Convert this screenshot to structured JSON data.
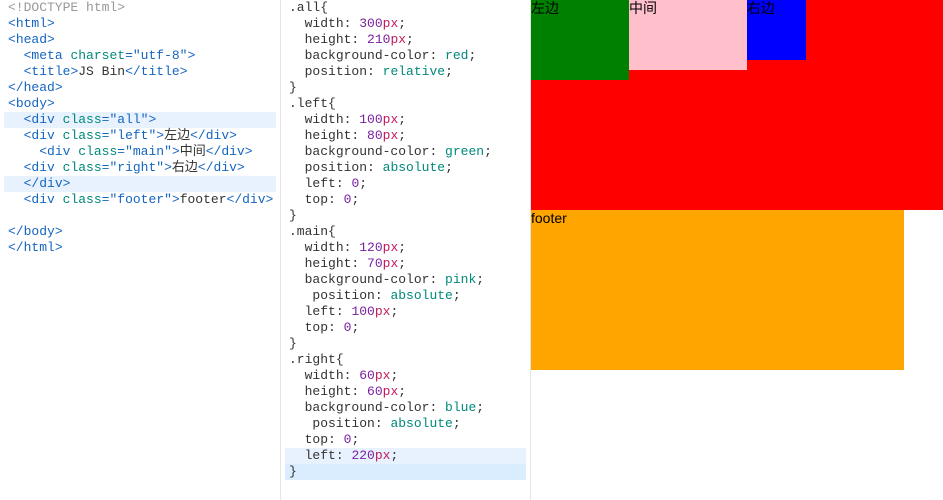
{
  "html_panel": {
    "lines": [
      {
        "kind": "plain",
        "segments": [
          [
            "doctype",
            "<!DOCTYPE html>"
          ]
        ]
      },
      {
        "kind": "opentag",
        "tag": "html",
        "attrs": []
      },
      {
        "kind": "opentag",
        "tag": "head",
        "attrs": []
      },
      {
        "kind": "plain",
        "segments": [
          [
            "text",
            "  "
          ],
          [
            "punc",
            "<"
          ],
          [
            "tag",
            "meta"
          ],
          [
            "text",
            " "
          ],
          [
            "attr",
            "charset"
          ],
          [
            "punc",
            "="
          ],
          [
            "str",
            "\"utf-8\""
          ],
          [
            "punc",
            ">"
          ]
        ]
      },
      {
        "kind": "plain",
        "segments": [
          [
            "text",
            "  "
          ],
          [
            "punc",
            "<"
          ],
          [
            "tag",
            "title"
          ],
          [
            "punc",
            ">"
          ],
          [
            "text",
            "JS Bin"
          ],
          [
            "punc",
            "</"
          ],
          [
            "tag",
            "title"
          ],
          [
            "punc",
            ">"
          ]
        ]
      },
      {
        "kind": "closetag",
        "tag": "head"
      },
      {
        "kind": "opentag",
        "tag": "body",
        "attrs": []
      },
      {
        "kind": "hl",
        "segments": [
          [
            "text",
            "  "
          ],
          [
            "punc",
            "<"
          ],
          [
            "tag",
            "div"
          ],
          [
            "text",
            " "
          ],
          [
            "attr",
            "class"
          ],
          [
            "punc",
            "="
          ],
          [
            "str",
            "\"all\""
          ],
          [
            "punc",
            ">"
          ]
        ]
      },
      {
        "kind": "plain",
        "segments": [
          [
            "text",
            "  "
          ],
          [
            "punc",
            "<"
          ],
          [
            "tag",
            "div"
          ],
          [
            "text",
            " "
          ],
          [
            "attr",
            "class"
          ],
          [
            "punc",
            "="
          ],
          [
            "str",
            "\"left\""
          ],
          [
            "punc",
            ">"
          ],
          [
            "text",
            "左边"
          ],
          [
            "punc",
            "</"
          ],
          [
            "tag",
            "div"
          ],
          [
            "punc",
            ">"
          ]
        ]
      },
      {
        "kind": "plain",
        "segments": [
          [
            "text",
            "    "
          ],
          [
            "punc",
            "<"
          ],
          [
            "tag",
            "div"
          ],
          [
            "text",
            " "
          ],
          [
            "attr",
            "class"
          ],
          [
            "punc",
            "="
          ],
          [
            "str",
            "\"main\""
          ],
          [
            "punc",
            ">"
          ],
          [
            "text",
            "中间"
          ],
          [
            "punc",
            "</"
          ],
          [
            "tag",
            "div"
          ],
          [
            "punc",
            ">"
          ]
        ]
      },
      {
        "kind": "plain",
        "segments": [
          [
            "text",
            "  "
          ],
          [
            "punc",
            "<"
          ],
          [
            "tag",
            "div"
          ],
          [
            "text",
            " "
          ],
          [
            "attr",
            "class"
          ],
          [
            "punc",
            "="
          ],
          [
            "str",
            "\"right\""
          ],
          [
            "punc",
            ">"
          ],
          [
            "text",
            "右边"
          ],
          [
            "punc",
            "</"
          ],
          [
            "tag",
            "div"
          ],
          [
            "punc",
            ">"
          ]
        ]
      },
      {
        "kind": "hl",
        "segments": [
          [
            "text",
            "  "
          ],
          [
            "punc",
            "</"
          ],
          [
            "tag",
            "div"
          ],
          [
            "punc",
            ">"
          ]
        ]
      },
      {
        "kind": "plain",
        "segments": [
          [
            "text",
            "  "
          ],
          [
            "punc",
            "<"
          ],
          [
            "tag",
            "div"
          ],
          [
            "text",
            " "
          ],
          [
            "attr",
            "class"
          ],
          [
            "punc",
            "="
          ],
          [
            "str",
            "\"footer\""
          ],
          [
            "punc",
            ">"
          ],
          [
            "text",
            "footer"
          ],
          [
            "punc",
            "</"
          ],
          [
            "tag",
            "div"
          ],
          [
            "punc",
            ">"
          ]
        ]
      },
      {
        "kind": "plain",
        "segments": [
          [
            "text",
            "  "
          ]
        ]
      },
      {
        "kind": "closetag",
        "tag": "body"
      },
      {
        "kind": "closetag",
        "tag": "html"
      }
    ]
  },
  "css_panel": {
    "lines": [
      {
        "segments": [
          [
            "sel",
            ".all"
          ],
          [
            "brace",
            "{"
          ]
        ]
      },
      {
        "segments": [
          [
            "text",
            "  "
          ],
          [
            "prop",
            "width"
          ],
          [
            "text",
            ": "
          ],
          [
            "num",
            "300"
          ],
          [
            "unit",
            "px"
          ],
          [
            "text",
            ";"
          ]
        ]
      },
      {
        "segments": [
          [
            "text",
            "  "
          ],
          [
            "prop",
            "height"
          ],
          [
            "text",
            ": "
          ],
          [
            "num",
            "210"
          ],
          [
            "unit",
            "px"
          ],
          [
            "text",
            ";"
          ]
        ]
      },
      {
        "segments": [
          [
            "text",
            "  "
          ],
          [
            "prop",
            "background-color"
          ],
          [
            "text",
            ": "
          ],
          [
            "kw",
            "red"
          ],
          [
            "text",
            ";"
          ]
        ]
      },
      {
        "segments": [
          [
            "text",
            "  "
          ],
          [
            "prop",
            "position"
          ],
          [
            "text",
            ": "
          ],
          [
            "kw",
            "relative"
          ],
          [
            "text",
            ";"
          ]
        ]
      },
      {
        "segments": [
          [
            "brace",
            "}"
          ]
        ]
      },
      {
        "segments": [
          [
            "sel",
            ".left"
          ],
          [
            "brace",
            "{"
          ]
        ]
      },
      {
        "segments": [
          [
            "text",
            "  "
          ],
          [
            "prop",
            "width"
          ],
          [
            "text",
            ": "
          ],
          [
            "num",
            "100"
          ],
          [
            "unit",
            "px"
          ],
          [
            "text",
            ";"
          ]
        ]
      },
      {
        "segments": [
          [
            "text",
            "  "
          ],
          [
            "prop",
            "height"
          ],
          [
            "text",
            ": "
          ],
          [
            "num",
            "80"
          ],
          [
            "unit",
            "px"
          ],
          [
            "text",
            ";"
          ]
        ]
      },
      {
        "segments": [
          [
            "text",
            "  "
          ],
          [
            "prop",
            "background-color"
          ],
          [
            "text",
            ": "
          ],
          [
            "kw",
            "green"
          ],
          [
            "text",
            ";"
          ]
        ]
      },
      {
        "segments": [
          [
            "text",
            "  "
          ],
          [
            "prop",
            "position"
          ],
          [
            "text",
            ": "
          ],
          [
            "kw",
            "absolute"
          ],
          [
            "text",
            ";"
          ]
        ]
      },
      {
        "segments": [
          [
            "text",
            "  "
          ],
          [
            "prop",
            "left"
          ],
          [
            "text",
            ": "
          ],
          [
            "zero",
            "0"
          ],
          [
            "text",
            ";"
          ]
        ]
      },
      {
        "segments": [
          [
            "text",
            "  "
          ],
          [
            "prop",
            "top"
          ],
          [
            "text",
            ": "
          ],
          [
            "zero",
            "0"
          ],
          [
            "text",
            ";"
          ]
        ]
      },
      {
        "segments": [
          [
            "brace",
            "}"
          ]
        ]
      },
      {
        "segments": [
          [
            "sel",
            ".main"
          ],
          [
            "brace",
            "{"
          ]
        ]
      },
      {
        "segments": [
          [
            "text",
            "  "
          ],
          [
            "prop",
            "width"
          ],
          [
            "text",
            ": "
          ],
          [
            "num",
            "120"
          ],
          [
            "unit",
            "px"
          ],
          [
            "text",
            ";"
          ]
        ]
      },
      {
        "segments": [
          [
            "text",
            "  "
          ],
          [
            "prop",
            "height"
          ],
          [
            "text",
            ": "
          ],
          [
            "num",
            "70"
          ],
          [
            "unit",
            "px"
          ],
          [
            "text",
            ";"
          ]
        ]
      },
      {
        "segments": [
          [
            "text",
            "  "
          ],
          [
            "prop",
            "background-color"
          ],
          [
            "text",
            ": "
          ],
          [
            "kw",
            "pink"
          ],
          [
            "text",
            ";"
          ]
        ]
      },
      {
        "segments": [
          [
            "text",
            "   "
          ],
          [
            "prop",
            "position"
          ],
          [
            "text",
            ": "
          ],
          [
            "kw",
            "absolute"
          ],
          [
            "text",
            ";"
          ]
        ]
      },
      {
        "segments": [
          [
            "text",
            "  "
          ],
          [
            "prop",
            "left"
          ],
          [
            "text",
            ": "
          ],
          [
            "num",
            "100"
          ],
          [
            "unit",
            "px"
          ],
          [
            "text",
            ";"
          ]
        ]
      },
      {
        "segments": [
          [
            "text",
            "  "
          ],
          [
            "prop",
            "top"
          ],
          [
            "text",
            ": "
          ],
          [
            "zero",
            "0"
          ],
          [
            "text",
            ";"
          ]
        ]
      },
      {
        "segments": [
          [
            "brace",
            "}"
          ]
        ]
      },
      {
        "segments": [
          [
            "sel",
            ".right"
          ],
          [
            "brace",
            "{"
          ]
        ]
      },
      {
        "segments": [
          [
            "text",
            "  "
          ],
          [
            "prop",
            "width"
          ],
          [
            "text",
            ": "
          ],
          [
            "num",
            "60"
          ],
          [
            "unit",
            "px"
          ],
          [
            "text",
            ";"
          ]
        ]
      },
      {
        "segments": [
          [
            "text",
            "  "
          ],
          [
            "prop",
            "height"
          ],
          [
            "text",
            ": "
          ],
          [
            "num",
            "60"
          ],
          [
            "unit",
            "px"
          ],
          [
            "text",
            ";"
          ]
        ]
      },
      {
        "segments": [
          [
            "text",
            "  "
          ],
          [
            "prop",
            "background-color"
          ],
          [
            "text",
            ": "
          ],
          [
            "kw",
            "blue"
          ],
          [
            "text",
            ";"
          ]
        ]
      },
      {
        "segments": [
          [
            "text",
            "   "
          ],
          [
            "prop",
            "position"
          ],
          [
            "text",
            ": "
          ],
          [
            "kw",
            "absolute"
          ],
          [
            "text",
            ";"
          ]
        ]
      },
      {
        "segments": [
          [
            "text",
            "  "
          ],
          [
            "prop",
            "top"
          ],
          [
            "text",
            ": "
          ],
          [
            "zero",
            "0"
          ],
          [
            "text",
            ";"
          ]
        ]
      },
      {
        "kind": "hl",
        "segments": [
          [
            "text",
            "  "
          ],
          [
            "prop",
            "left"
          ],
          [
            "text",
            ": "
          ],
          [
            "num",
            "220"
          ],
          [
            "unit",
            "px"
          ],
          [
            "text",
            ";"
          ]
        ]
      },
      {
        "kind": "cur",
        "segments": [
          [
            "brace",
            "}"
          ]
        ]
      }
    ]
  },
  "output_panel": {
    "left_label": "左边",
    "main_label": "中间",
    "right_label": "右边",
    "footer_label": "footer"
  }
}
